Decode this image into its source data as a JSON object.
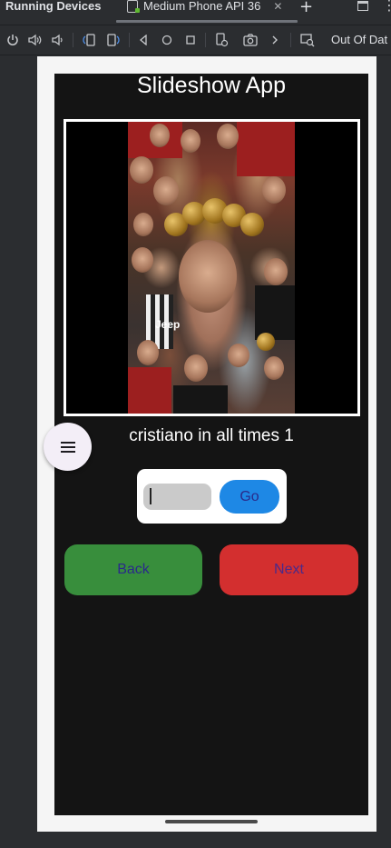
{
  "ide": {
    "panel_title": "Running Devices",
    "device_tab": {
      "label": "Medium Phone API 36",
      "close": "✕"
    },
    "add_tab": "+",
    "toolbar": {
      "icons": [
        "power-icon",
        "volume-up-icon",
        "volume-down-icon",
        "rotate-left-icon",
        "rotate-right-icon",
        "back-icon",
        "home-icon",
        "overview-icon",
        "snapshot-icon",
        "camera-icon",
        "more-chevron-icon",
        "inspect-icon"
      ],
      "status_text": "Out Of Dat"
    }
  },
  "app": {
    "title": "Slideshow App",
    "image": {
      "alt_label": "cristiano in all times 1"
    },
    "caption": "cristiano in all times 1",
    "menu_fab": {
      "icon": "menu-icon"
    },
    "goto": {
      "input_value": "",
      "go_label": "Go"
    },
    "back_label": "Back",
    "next_label": "Next"
  },
  "colors": {
    "screen_bg": "#141414",
    "back_button": "#388e3c",
    "next_button": "#d32f2f",
    "go_button": "#1e88e5",
    "ide_bg": "#2b2d30"
  }
}
